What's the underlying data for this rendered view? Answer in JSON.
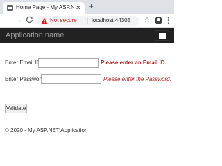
{
  "browser": {
    "tab_title": "Home Page - My ASP.NET Applic",
    "tab_close": "✕",
    "new_tab": "+",
    "back": "←",
    "forward": "→",
    "reload": "C",
    "security_text": "Not secure",
    "url": "localhost:44305",
    "star": "☆",
    "menu": "⋮",
    "warning_color": "#c5221f"
  },
  "navbar": {
    "brand": "Application name",
    "background": "#222222"
  },
  "form": {
    "email_label": "Enter Email ID",
    "email_value": "",
    "email_error": "Please enter an Email ID.",
    "password_label": "Enter Password",
    "password_value": "",
    "password_error": "Please enter the Password.",
    "validate_label": "Validate",
    "error_color": "#b22222"
  },
  "footer": {
    "text": "© 2020 - My ASP.NET Application"
  },
  "icons": {
    "favicon": "page-icon",
    "security": "warning-triangle-icon",
    "profile": "account-icon",
    "navbar_toggle": "hamburger-icon"
  }
}
